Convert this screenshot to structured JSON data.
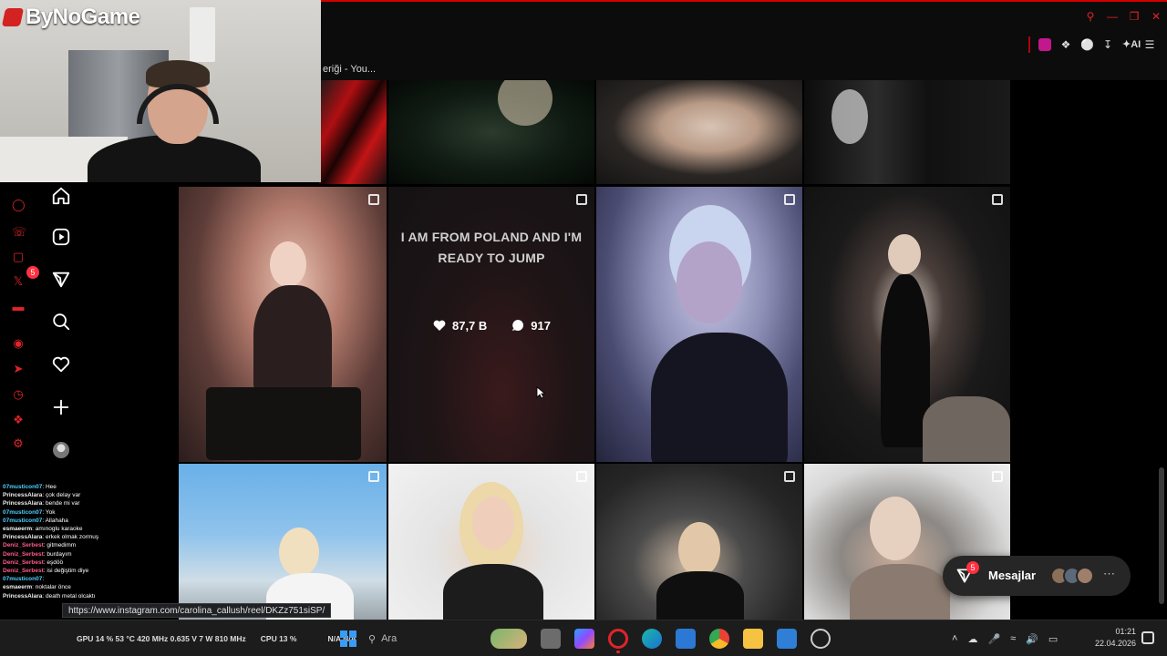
{
  "stream": {
    "logo_text": "ByNoGame"
  },
  "browser": {
    "tab_title": "eriği - You...",
    "toolbar_ai_label": "AI",
    "accent_color": "#e0242a"
  },
  "nav": {
    "notifications_badge": "5"
  },
  "grid": {
    "hover_post": {
      "caption": "I AM FROM POLAND AND I'M READY TO JUMP",
      "likes": "87,7 B",
      "comments": "917"
    }
  },
  "chat": {
    "lines": [
      {
        "user": "07musticon07",
        "text": ": Hee",
        "color": "#4fd1ff"
      },
      {
        "user": "PrincessAlara",
        "text": ": çok delay var",
        "color": "#f0f0f0"
      },
      {
        "user": "PrincessAlara",
        "text": ": bende mi var",
        "color": "#f0f0f0"
      },
      {
        "user": "07musticon07",
        "text": ": Yok",
        "color": "#4fd1ff"
      },
      {
        "user": "07musticon07",
        "text": ": Allahaha",
        "color": "#4fd1ff"
      },
      {
        "user": "esmaeerm",
        "text": ": amınoglu karaoke",
        "color": "#f0f0f0"
      },
      {
        "user": "PrincessAlara",
        "text": ": erkek olmak zormuş",
        "color": "#f0f0f0"
      },
      {
        "user": "Deniz_Serbest",
        "text": ": gitmedimm",
        "color": "#ff5c8a"
      },
      {
        "user": "Deniz_Serbest",
        "text": ": burdayım",
        "color": "#ff5c8a"
      },
      {
        "user": "Deniz_Serbest",
        "text": ": eşdöö",
        "color": "#ff5c8a"
      },
      {
        "user": "Deniz_Serbest",
        "text": ": isi değiştim diye",
        "color": "#ff5c8a"
      },
      {
        "user": "07musticon07",
        "text": ": ",
        "color": "#4fd1ff"
      },
      {
        "user": "esmaeerm",
        "text": ": noktalar önce",
        "color": "#f0f0f0"
      },
      {
        "user": "PrincessAlara",
        "text": ": death metal olcaktı",
        "color": "#f0f0f0"
      }
    ]
  },
  "status_url": "https://www.instagram.com/carolina_callush/reel/DKZz751siSP/",
  "messages": {
    "label": "Mesajlar",
    "badge": "5"
  },
  "taskbar": {
    "gpu": "GPU  14 %  53 °C  420 MHz  0.635 V  7 W  810 MHz",
    "cpu": "CPU  13 %",
    "net": "N/A  N/A",
    "search_placeholder": "Ara",
    "time": "01:21",
    "date": "22.04.2026"
  }
}
